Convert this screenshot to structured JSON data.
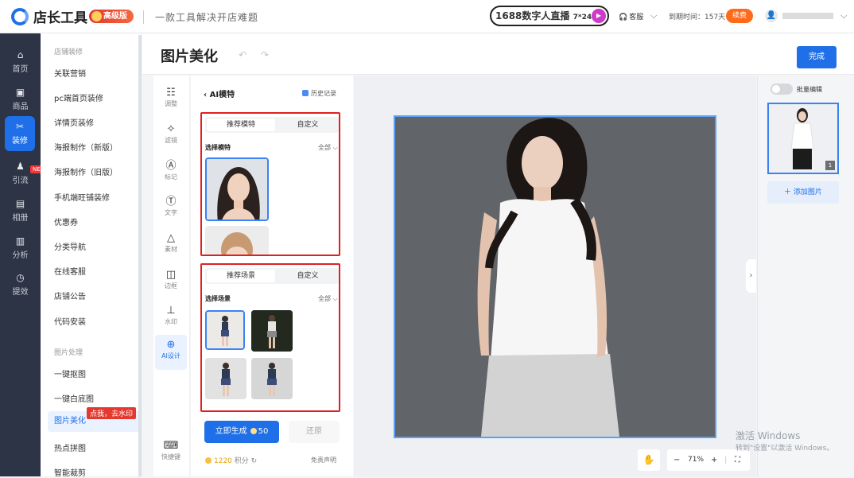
{
  "app": {
    "logo_text": "店长工具",
    "badge": "高级版",
    "slogan": "一款工具解决开店难题",
    "live_banner": "1688数字人直播",
    "live_hours": "7*24h",
    "service": "客服",
    "expire_text": "到期时间：157天",
    "renew_label": "续费",
    "accent": "#1e6fe8"
  },
  "left_nav": [
    {
      "label": "首页",
      "icon": "home-icon"
    },
    {
      "label": "商品",
      "icon": "bag-icon"
    },
    {
      "label": "装修",
      "icon": "brush-icon"
    },
    {
      "label": "引流",
      "icon": "person-icon"
    },
    {
      "label": "相册",
      "icon": "image-icon"
    },
    {
      "label": "分析",
      "icon": "chart-icon"
    },
    {
      "label": "提效",
      "icon": "clock-icon"
    }
  ],
  "nav_new_badge": "NEW",
  "menu": {
    "group1": "店铺装修",
    "items1": [
      "关联营销",
      "pc端首页装修",
      "详情页装修",
      "海报制作（新版）",
      "海报制作（旧版）",
      "手机端旺铺装修",
      "优惠券",
      "分类导航",
      "在线客服",
      "店铺公告",
      "代码安装"
    ],
    "group2": "图片处理",
    "items2": [
      "一键抠图",
      "一键白底图",
      "图片美化",
      "热点拼图",
      "智能裁剪"
    ],
    "tip": "点我，去水印"
  },
  "page": {
    "title": "图片美化",
    "finish_label": "完成"
  },
  "tools": [
    {
      "label": "调整",
      "icon": "sliders-icon"
    },
    {
      "label": "滤镜",
      "icon": "magic-wand-icon"
    },
    {
      "label": "标记",
      "icon": "pen-icon"
    },
    {
      "label": "文字",
      "icon": "text-icon"
    },
    {
      "label": "素材",
      "icon": "shapes-icon"
    },
    {
      "label": "边框",
      "icon": "frame-icon"
    },
    {
      "label": "水印",
      "icon": "stamp-icon"
    },
    {
      "label": "AI设计",
      "icon": "ai-icon"
    },
    {
      "label": "快捷键",
      "icon": "keyboard-icon"
    }
  ],
  "panel": {
    "back_title": "AI模特",
    "history": "历史记录",
    "model_tabs": [
      "推荐模特",
      "自定义"
    ],
    "model_section": "选择模特",
    "scene_tabs": [
      "推荐场景",
      "自定义"
    ],
    "scene_section": "选择场景",
    "all_label": "全部",
    "generate_label": "立即生成",
    "generate_cost": "50",
    "restore_label": "还原",
    "points_value": "1220",
    "points_unit": "积分",
    "disclaimer": "免责声明"
  },
  "canvas": {
    "zoom": "71%"
  },
  "right": {
    "batch_label": "批量编辑",
    "thumb_index": "1",
    "add_label": "添加图片"
  },
  "watermark": {
    "line1": "激活 Windows",
    "line2": "转到\"设置\"以激活 Windows。"
  }
}
